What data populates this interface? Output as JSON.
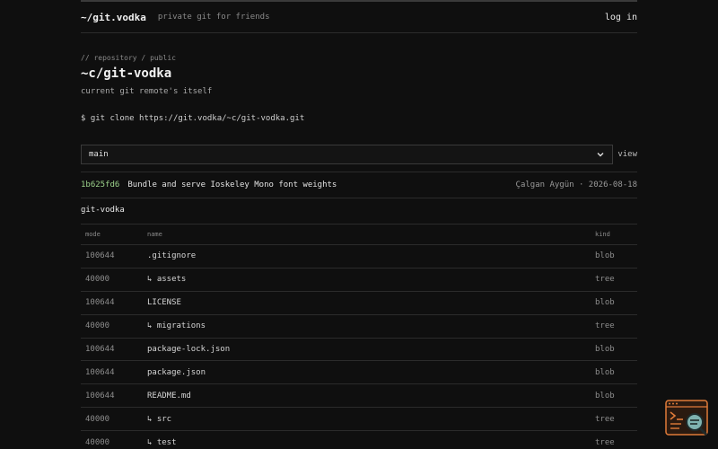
{
  "header": {
    "brand": "~/git.vodka",
    "tagline": "private git for friends",
    "login_label": "log in"
  },
  "repo": {
    "breadcrumb": "// repository / public",
    "title": "~c/git-vodka",
    "description": "current git remote's itself",
    "clone_command": "$ git clone https://git.vodka/~c/git-vodka.git"
  },
  "branch": {
    "selected": "main",
    "view_label": "view"
  },
  "commit": {
    "hash": "1b625fd6",
    "message": "Bundle and serve Ioskeley Mono font weights",
    "meta": "Çalgan Aygün · 2026-08-18"
  },
  "tree": {
    "title": "git-vodka",
    "columns": {
      "mode": "mode",
      "name": "name",
      "kind": "kind"
    },
    "rows": [
      {
        "mode": "100644",
        "name": ".gitignore",
        "kind": "blob"
      },
      {
        "mode": "40000",
        "name": "↳ assets",
        "kind": "tree"
      },
      {
        "mode": "100644",
        "name": "LICENSE",
        "kind": "blob"
      },
      {
        "mode": "40000",
        "name": "↳ migrations",
        "kind": "tree"
      },
      {
        "mode": "100644",
        "name": "package-lock.json",
        "kind": "blob"
      },
      {
        "mode": "100644",
        "name": "package.json",
        "kind": "blob"
      },
      {
        "mode": "100644",
        "name": "README.md",
        "kind": "blob"
      },
      {
        "mode": "40000",
        "name": "↳ src",
        "kind": "tree"
      },
      {
        "mode": "40000",
        "name": "↳ test",
        "kind": "tree"
      }
    ]
  },
  "colors": {
    "background": "#0f0f0f",
    "commit_hash": "#9bd18a",
    "widget_accent": "#e07b39"
  },
  "icons": {
    "branch_chevron": "chevron-down-icon",
    "floating_widget": "terminal-search-icon"
  }
}
